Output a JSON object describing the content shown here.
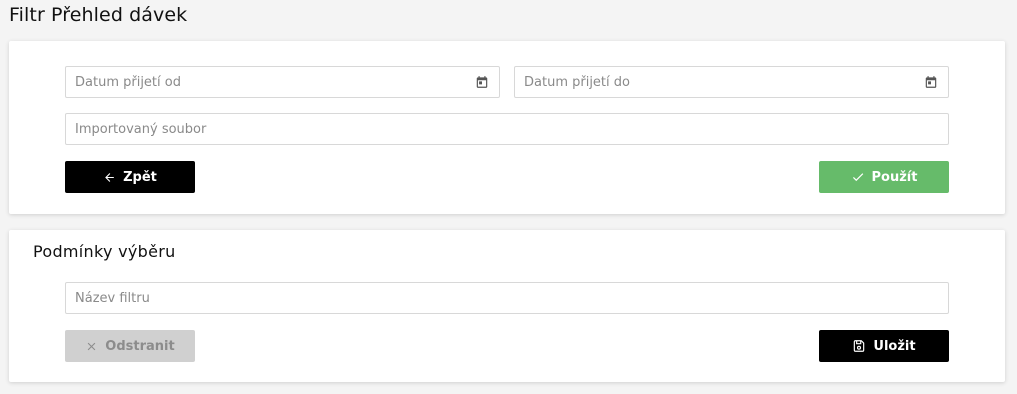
{
  "page": {
    "title": "Filtr Přehled dávek"
  },
  "filter": {
    "date_from": {
      "placeholder": "Datum přijetí od",
      "value": "",
      "icon": "calendar-icon"
    },
    "date_to": {
      "placeholder": "Datum přijetí do",
      "value": "",
      "icon": "calendar-icon"
    },
    "imported_file": {
      "placeholder": "Importovaný soubor",
      "value": ""
    },
    "back_button": {
      "label": "Zpět",
      "icon": "arrow-left-icon"
    },
    "apply_button": {
      "label": "Použít",
      "icon": "check-icon",
      "color": "#66bb6a"
    }
  },
  "conditions": {
    "title": "Podmínky výběru",
    "filter_name": {
      "placeholder": "Název filtru",
      "value": ""
    },
    "remove_button": {
      "label": "Odstranit",
      "icon": "close-icon",
      "disabled": true
    },
    "save_button": {
      "label": "Uložit",
      "icon": "save-icon"
    }
  }
}
